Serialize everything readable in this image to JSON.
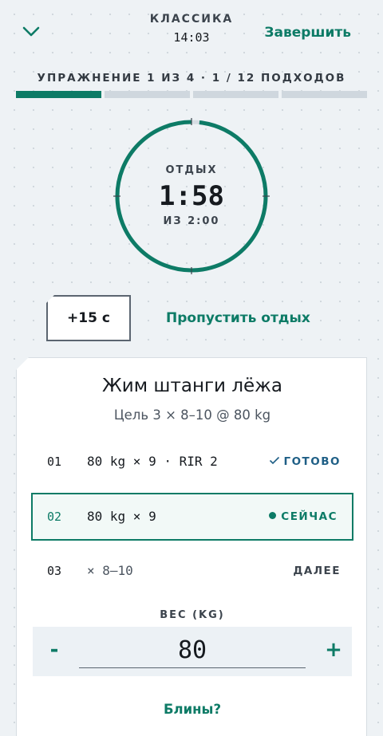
{
  "header": {
    "program": "КЛАССИКА",
    "elapsed": "14:03",
    "finish_label": "Завершить"
  },
  "progress": {
    "label": "УПРАЖНЕНИЕ 1 ИЗ 4 · 1 / 12 ПОДХОДОВ",
    "exercise_current": 1,
    "exercise_total": 4,
    "colors": {
      "done": "#0d7b66",
      "pending": "#cfd7de"
    }
  },
  "rest": {
    "label": "ОТДЫХ",
    "remaining": "1:58",
    "total": "ИЗ 2:00",
    "remaining_fraction": 0.983,
    "add_label": "+15 с",
    "skip_label": "Пропустить отдых"
  },
  "exercise": {
    "name": "Жим штанги лёжа",
    "goal": "Цель 3 × 8–10 @ 80 kg",
    "sets": [
      {
        "num": "01",
        "desc": "80 kg × 9 · RIR 2",
        "status": "ГОТОВО",
        "state": "done"
      },
      {
        "num": "02",
        "desc": "80 kg × 9",
        "status": "СЕЙЧАС",
        "state": "current"
      },
      {
        "num": "03",
        "desc": "× 8–10",
        "status": "ДАЛЕЕ",
        "state": "upcoming"
      }
    ]
  },
  "weight": {
    "label": "ВЕС (KG)",
    "value": "80",
    "minus": "-",
    "plus": "+"
  },
  "plates_label": "Блины?",
  "colors": {
    "accent": "#0d7b66",
    "done_status": "#1f5f86"
  }
}
